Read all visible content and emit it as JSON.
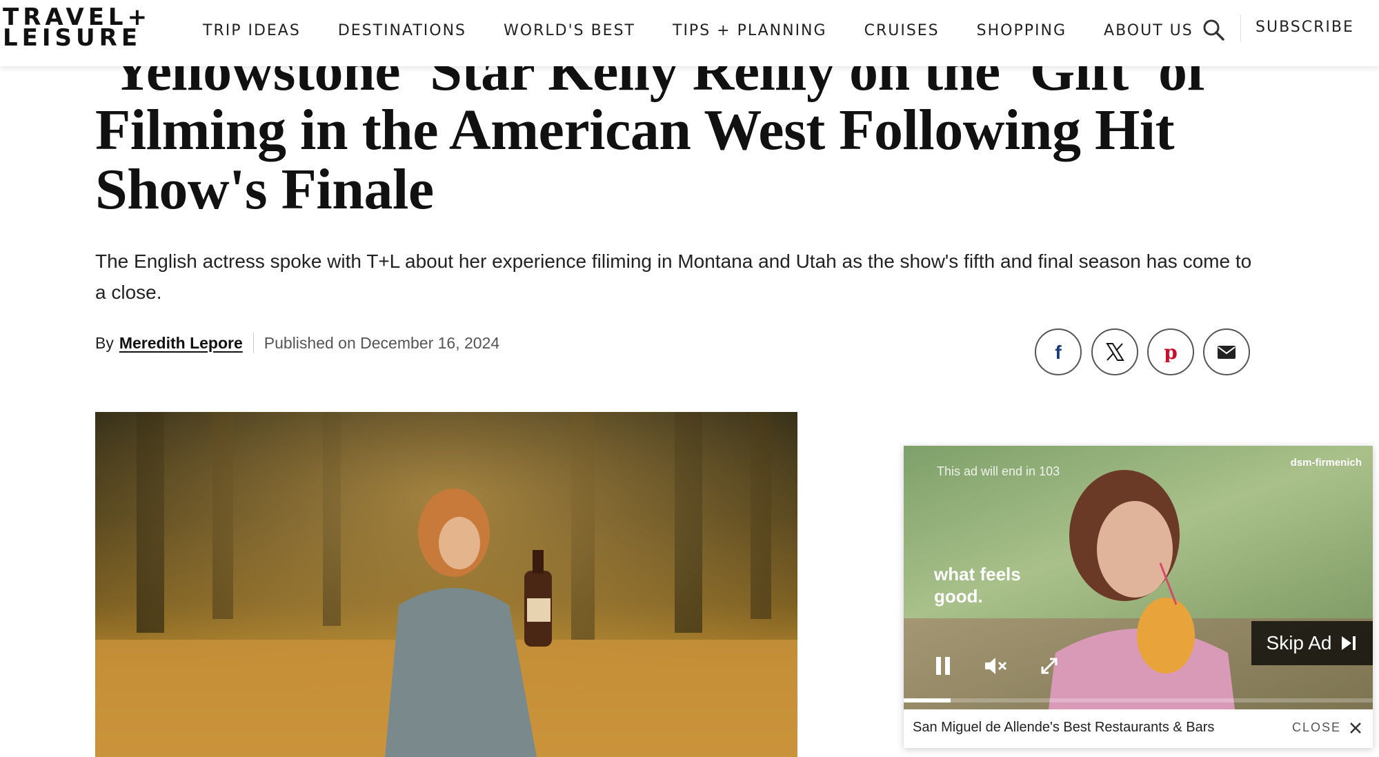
{
  "header": {
    "logo": {
      "line1": "TRAVEL+",
      "line2": "LEISURE"
    },
    "nav": [
      {
        "label": "TRIP IDEAS"
      },
      {
        "label": "DESTINATIONS"
      },
      {
        "label": "WORLD'S BEST"
      },
      {
        "label": "TIPS + PLANNING"
      },
      {
        "label": "CRUISES"
      },
      {
        "label": "SHOPPING"
      },
      {
        "label": "ABOUT US"
      }
    ],
    "search_icon": "search-icon",
    "subscribe_label": "SUBSCRIBE"
  },
  "article": {
    "headline": "'Yellowstone' Star Kelly Reilly on the 'Gift' of Filming in the American West Following Hit Show's Finale",
    "dek": "The English actress spoke with T+L about her experience filiming in Montana and Utah as the show's fifth and final season has come to a close.",
    "byline": {
      "prefix": "By",
      "author": "Meredith Lepore",
      "published": "Published on December 16, 2024"
    },
    "share_icons": [
      "facebook-icon",
      "x-icon",
      "pinterest-icon",
      "email-icon"
    ]
  },
  "ad": {
    "timer_text": "This ad will end in 103",
    "brand": "dsm-firmenich",
    "tagline": "what feels good.",
    "skip_label": "Skip Ad",
    "progress": 0.1,
    "caption": "San Miguel de Allende's Best Restaurants & Bars",
    "close_label": "CLOSE"
  },
  "colors": {
    "text": "#111111",
    "nav_text": "#222222",
    "muted": "#555555"
  }
}
